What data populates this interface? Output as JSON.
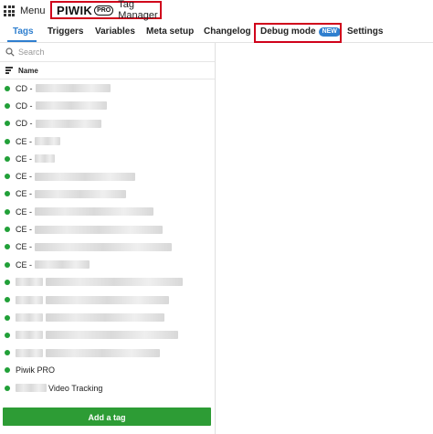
{
  "header": {
    "menu_label": "Menu",
    "brand_name": "PIWIK",
    "brand_badge": "PRO",
    "product_name": "Tag Manager"
  },
  "tabs": [
    {
      "label": "Tags",
      "active": true
    },
    {
      "label": "Triggers"
    },
    {
      "label": "Variables"
    },
    {
      "label": "Meta setup"
    },
    {
      "label": "Changelog"
    },
    {
      "label": "Debug mode",
      "badge": "NEW"
    },
    {
      "label": "Settings"
    }
  ],
  "search": {
    "placeholder": "Search"
  },
  "list": {
    "column_header": "Name",
    "status_color": "#21a038",
    "rows": [
      {
        "prefix": "CD - "
      },
      {
        "prefix": "CD - "
      },
      {
        "prefix": "CD - "
      },
      {
        "prefix": "CE - "
      },
      {
        "prefix": "CE - "
      },
      {
        "prefix": "CE - "
      },
      {
        "prefix": "CE - "
      },
      {
        "prefix": "CE - "
      },
      {
        "prefix": "CE - "
      },
      {
        "prefix": "CE - "
      },
      {
        "prefix": "CE - "
      },
      {
        "prefix": ""
      },
      {
        "prefix": ""
      },
      {
        "prefix": ""
      },
      {
        "prefix": ""
      },
      {
        "prefix": ""
      },
      {
        "prefix": "Piwik PRO"
      },
      {
        "prefix": "",
        "suffix": "Video Tracking"
      }
    ]
  },
  "add_button": {
    "label": "Add a tag",
    "color": "#2d9c35"
  },
  "accent_color": "#2f7fcf",
  "highlight_color": "#d0021b"
}
